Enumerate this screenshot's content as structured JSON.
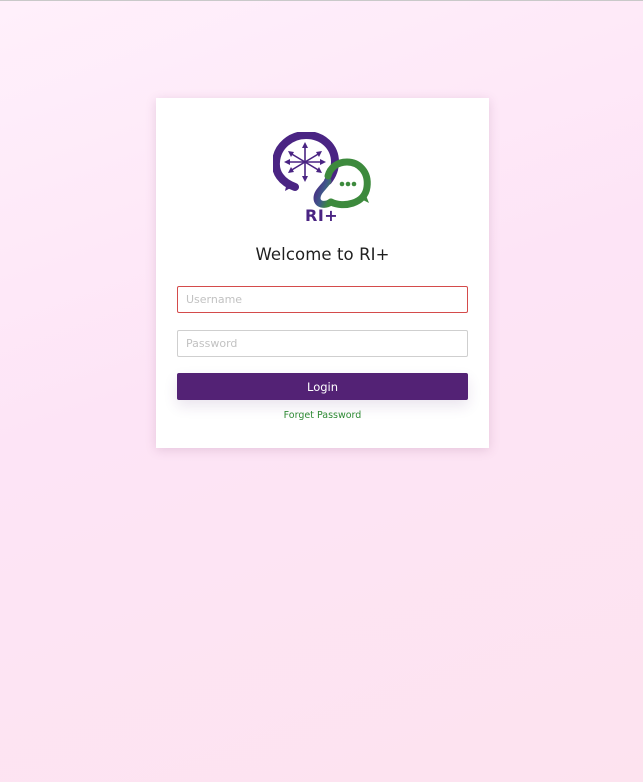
{
  "brand": {
    "logo_text": "RI+",
    "logo_icon": "compass-chat-logo",
    "primary_color": "#532275",
    "secondary_color": "#3d8a3d"
  },
  "login": {
    "welcome_text": "Welcome to RI+",
    "username_placeholder": "Username",
    "username_value": "",
    "password_placeholder": "Password",
    "password_value": "",
    "login_label": "Login",
    "forget_password_label": "Forget Password",
    "error_color": "#d44b4b",
    "link_color": "#2e8a34"
  }
}
